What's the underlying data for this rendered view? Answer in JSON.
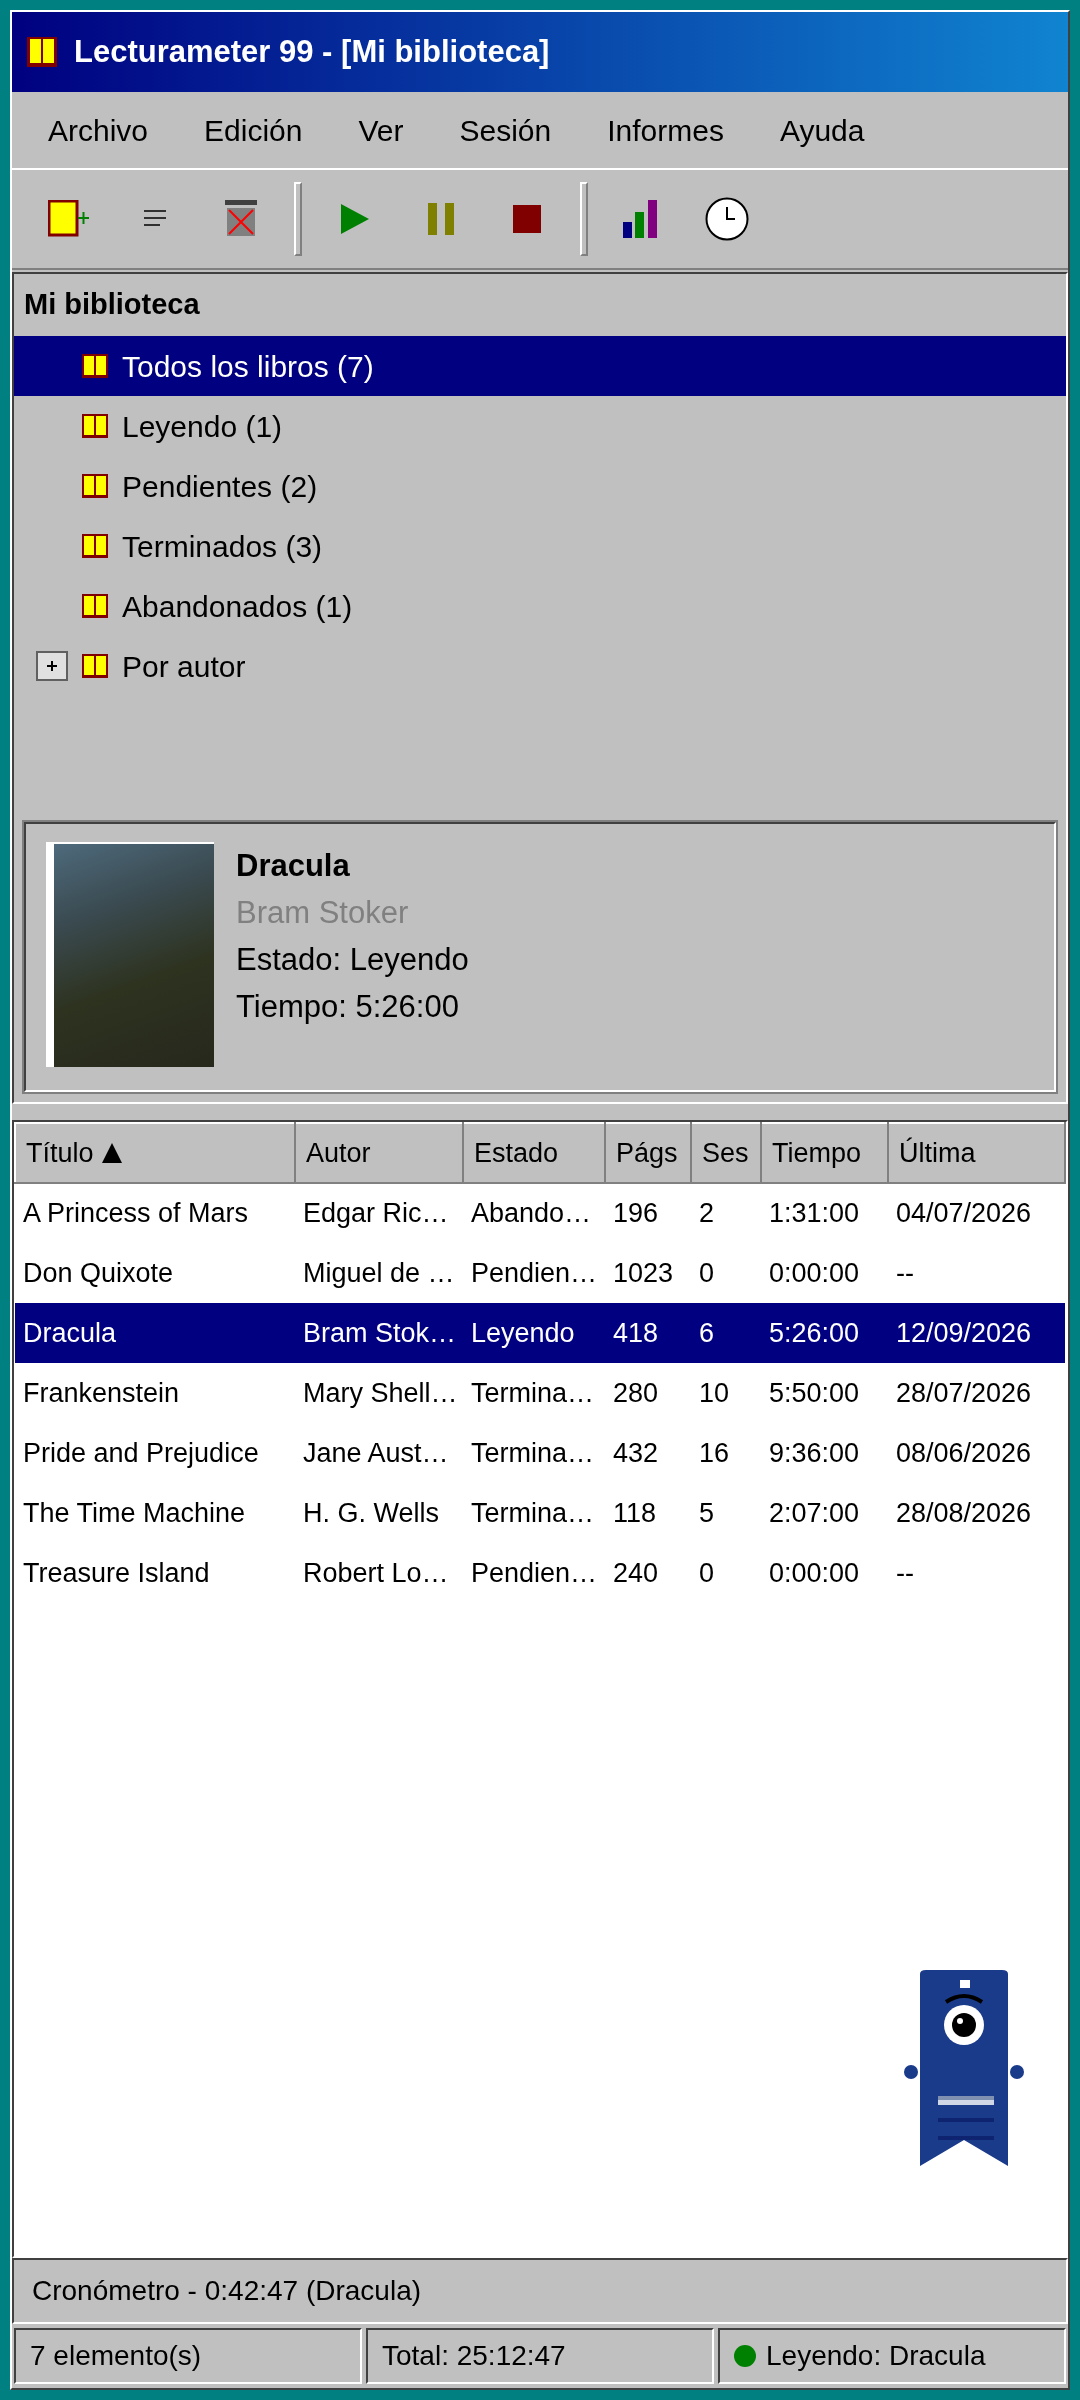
{
  "window": {
    "title": "Lecturameter 99 - [Mi biblioteca]"
  },
  "menu": [
    "Archivo",
    "Edición",
    "Ver",
    "Sesión",
    "Informes",
    "Ayuda"
  ],
  "tree": {
    "title": "Mi biblioteca",
    "items": [
      {
        "kind": "leaf",
        "label": "Todos los libros (7)",
        "selected": true
      },
      {
        "kind": "leaf",
        "label": "Leyendo (1)",
        "selected": false
      },
      {
        "kind": "leaf",
        "label": "Pendientes (2)",
        "selected": false
      },
      {
        "kind": "leaf",
        "label": "Terminados (3)",
        "selected": false
      },
      {
        "kind": "leaf",
        "label": "Abandonados (1)",
        "selected": false
      },
      {
        "kind": "group",
        "label": "Por autor",
        "selected": false,
        "expanded": false
      }
    ]
  },
  "details": {
    "title": "Dracula",
    "author": "Bram Stoker",
    "status": "Estado: Leyendo",
    "time": "Tiempo: 5:26:00"
  },
  "table": {
    "columns": [
      {
        "label": "Título",
        "sorted": true
      },
      {
        "label": "Autor",
        "sorted": false
      },
      {
        "label": "Estado",
        "sorted": false
      },
      {
        "label": "Págs",
        "sorted": false
      },
      {
        "label": "Ses",
        "sorted": false
      },
      {
        "label": "Tiempo",
        "sorted": false
      },
      {
        "label": "Última",
        "sorted": false
      }
    ],
    "rows": [
      {
        "cells": [
          "A Princess of Mars",
          "Edgar Ric…",
          "Abando…",
          "196",
          "2",
          "1:31:00",
          "04/07/2026"
        ],
        "selected": false
      },
      {
        "cells": [
          "Don Quixote",
          "Miguel de …",
          "Pendien…",
          "1023",
          "0",
          "0:00:00",
          "--"
        ],
        "selected": false
      },
      {
        "cells": [
          "Dracula",
          "Bram Stok…",
          "Leyendo",
          "418",
          "6",
          "5:26:00",
          "12/09/2026"
        ],
        "selected": true
      },
      {
        "cells": [
          "Frankenstein",
          "Mary Shell…",
          "Termina…",
          "280",
          "10",
          "5:50:00",
          "28/07/2026"
        ],
        "selected": false
      },
      {
        "cells": [
          "Pride and Prejudice",
          "Jane Aust…",
          "Termina…",
          "432",
          "16",
          "9:36:00",
          "08/06/2026"
        ],
        "selected": false
      },
      {
        "cells": [
          "The Time Machine",
          "H. G. Wells",
          "Termina…",
          "118",
          "5",
          "2:07:00",
          "28/08/2026"
        ],
        "selected": false
      },
      {
        "cells": [
          "Treasure Island",
          "Robert Lo…",
          "Pendien…",
          "240",
          "0",
          "0:00:00",
          "--"
        ],
        "selected": false
      }
    ]
  },
  "timer": "Cronómetro - 0:42:47 (Dracula)",
  "status_bar": [
    {
      "text": "7 elemento(s)"
    },
    {
      "text": "Total: 25:12:47"
    },
    {
      "text": "Leyendo: Dracula",
      "color": "#008000"
    }
  ]
}
